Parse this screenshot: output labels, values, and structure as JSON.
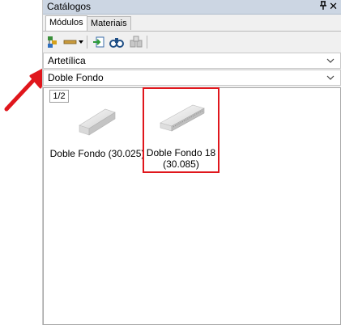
{
  "panel": {
    "title": "Catálogos",
    "pin_glyph": "⫧",
    "close_glyph": "✕"
  },
  "tabs": [
    {
      "label": "Módulos",
      "active": true
    },
    {
      "label": "Materiais",
      "active": false
    }
  ],
  "toolbar": {
    "icons": [
      "catalog-tree-icon",
      "ruler-dropdown-icon",
      "import-icon",
      "find-icon",
      "blocks-icon"
    ]
  },
  "combos": {
    "category": {
      "value": "Artetílica"
    },
    "subcategory": {
      "value": "Doble Fondo"
    }
  },
  "content": {
    "page_indicator": "1/2",
    "items": [
      {
        "label": "Doble Fondo (30.025)",
        "selected": false
      },
      {
        "label_line1": "Doble Fondo 18",
        "label_line2": "(30.085)",
        "selected": true
      }
    ]
  },
  "colors": {
    "highlight": "#e0161c",
    "titlebar": "#ccd6e3"
  }
}
